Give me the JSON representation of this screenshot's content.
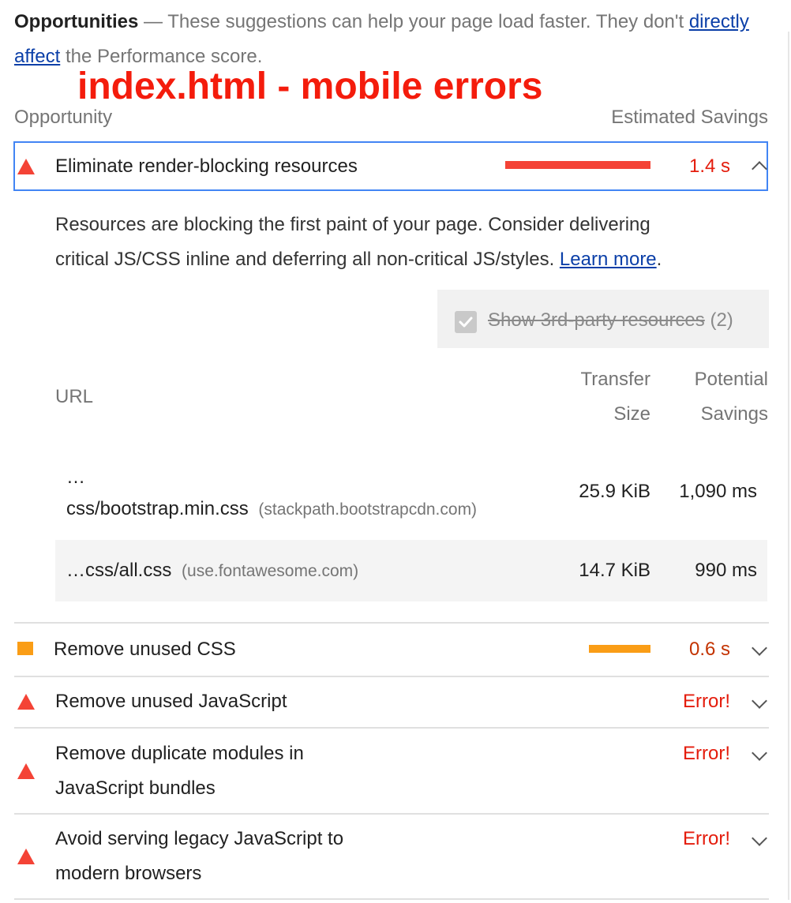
{
  "header": {
    "title": "Opportunities",
    "dash": "—",
    "text_before_link": "These suggestions can help your page load faster. They don't",
    "link": "directly affect",
    "text_after_link": "the Performance score."
  },
  "overlay_label": "index.html - mobile errors",
  "columns": {
    "opportunity": "Opportunity",
    "savings": "Estimated Savings"
  },
  "audits": [
    {
      "title": "Eliminate render-blocking resources",
      "savings": "1.4 s",
      "severity": "fail",
      "bar_fraction": 1.0,
      "color": "#f44336",
      "expanded": true
    },
    {
      "title": "Remove unused CSS",
      "savings": "0.6 s",
      "severity": "average",
      "bar_fraction": 0.43,
      "color": "#fa9d16"
    },
    {
      "title": "Remove unused JavaScript",
      "savings": "Error!",
      "severity": "fail"
    },
    {
      "title_line1": "Remove duplicate modules in",
      "title_line2": "JavaScript bundles",
      "savings": "Error!",
      "severity": "fail"
    },
    {
      "title_line1": "Avoid serving legacy JavaScript to",
      "title_line2": "modern browsers",
      "savings": "Error!",
      "severity": "fail"
    }
  ],
  "details": {
    "description_line1": "Resources are blocking the first paint of your page. Consider delivering",
    "description_line2": "critical JS/CSS inline and deferring all non-critical JS/styles.",
    "learn_more": "Learn more",
    "period": ".",
    "third_party_label": "Show 3rd-party resources",
    "third_party_count": "(2)",
    "third_party_checked": true,
    "table": {
      "headers": {
        "url": "URL",
        "transfer_line1": "Transfer",
        "transfer_line2": "Size",
        "savings_line1": "Potential",
        "savings_line2": "Savings"
      },
      "rows": [
        {
          "url_prefix": "…",
          "url": "css/bootstrap.min.css",
          "host": "(stackpath.bootstrapcdn.com)",
          "size": "25.9 KiB",
          "savings": "1,090 ms"
        },
        {
          "url": "…css/all.css",
          "host": "(use.fontawesome.com)",
          "size": "14.7 KiB",
          "savings": "990 ms"
        }
      ]
    }
  },
  "colors": {
    "fail": "#f44336",
    "average": "#fa9d16",
    "link": "#0b3fa8",
    "focus_border": "#4285f4"
  }
}
